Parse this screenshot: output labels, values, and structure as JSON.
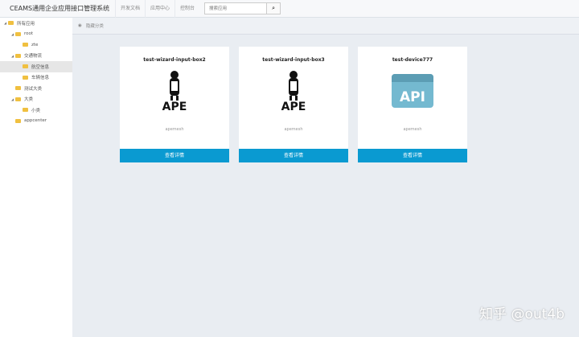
{
  "header": {
    "title": "CEAMS通用企业应用接口管理系统",
    "nav": [
      "开发文档",
      "应用中心",
      "控制台"
    ],
    "search_placeholder": "搜索应用"
  },
  "tree": [
    {
      "label": "所有应用",
      "level": 0,
      "expanded": true
    },
    {
      "label": "root",
      "level": 1,
      "expanded": true
    },
    {
      "label": "zte",
      "level": 2
    },
    {
      "label": "交通物流",
      "level": 1,
      "expanded": true
    },
    {
      "label": "航空信息",
      "level": 2,
      "selected": true
    },
    {
      "label": "车辆信息",
      "level": 2
    },
    {
      "label": "测试大类",
      "level": 1
    },
    {
      "label": "大类",
      "level": 1,
      "expanded": true
    },
    {
      "label": "小类",
      "level": 2
    },
    {
      "label": "appcenter",
      "level": 1
    }
  ],
  "breadcrumb": "隐藏分类",
  "cards": [
    {
      "title": "test-wizard-input-box2",
      "owner": "apemesh",
      "button": "查看详情",
      "logo": "APE"
    },
    {
      "title": "test-wizard-input-box3",
      "owner": "apemesh",
      "button": "查看详情",
      "logo": "APE"
    },
    {
      "title": "test-device777",
      "owner": "apemesh",
      "button": "查看详情",
      "logo": "API"
    }
  ],
  "watermark": "知乎 @out4b"
}
